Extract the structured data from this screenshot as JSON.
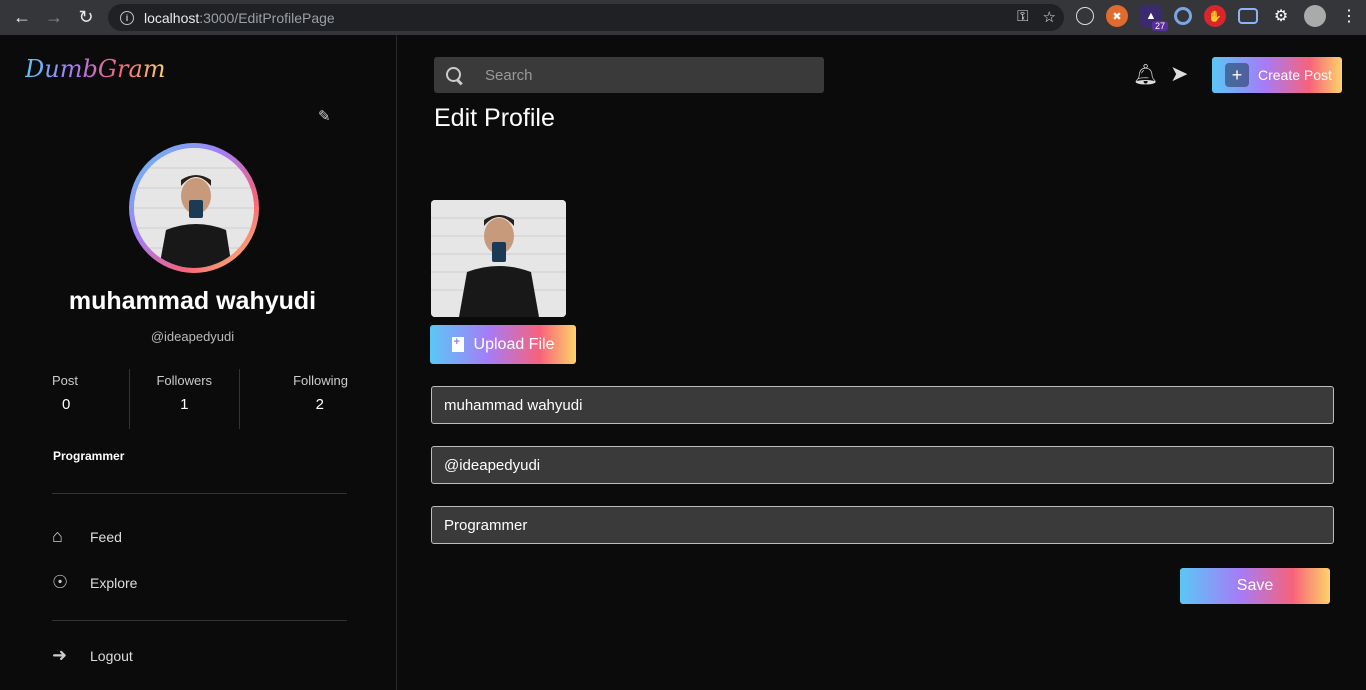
{
  "browser": {
    "url_host": "localhost",
    "url_path": ":3000/EditProfilePage",
    "extension_badge": "27"
  },
  "sidebar": {
    "logo": "DumbGram",
    "profile": {
      "name": "muhammad wahyudi",
      "handle": "@ideapedyudi",
      "bio": "Programmer"
    },
    "stats": [
      {
        "label": "Post",
        "value": "0"
      },
      {
        "label": "Followers",
        "value": "1"
      },
      {
        "label": "Following",
        "value": "2"
      }
    ],
    "menu": [
      {
        "label": "Feed",
        "icon": "home-icon"
      },
      {
        "label": "Explore",
        "icon": "compass-icon"
      }
    ],
    "logout_label": "Logout"
  },
  "header": {
    "search_placeholder": "Search",
    "create_post_label": "Create Post"
  },
  "main": {
    "title": "Edit Profile",
    "upload_label": "Upload File",
    "fields": {
      "name": "muhammad wahyudi",
      "username": "@ideapedyudi",
      "bio": "Programmer"
    },
    "save_label": "Save"
  },
  "colors": {
    "gradient": [
      "#5bc7f5",
      "#a57cf7",
      "#f7627b",
      "#fdd36a"
    ],
    "background": "#0b0b0b",
    "input_bg": "#3a3a3a"
  }
}
